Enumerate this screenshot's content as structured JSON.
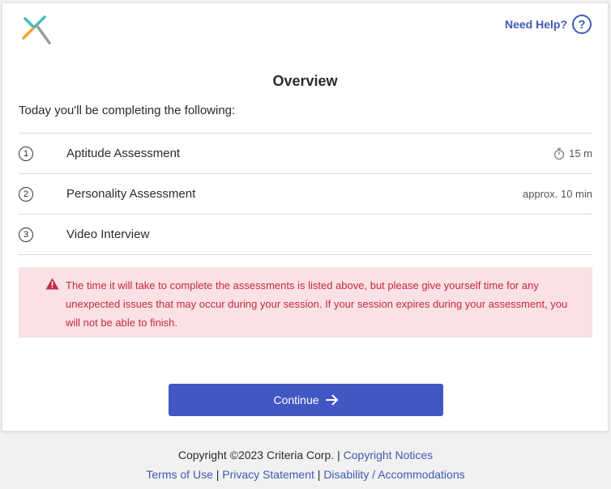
{
  "header": {
    "logo_icon": "criteria-x-logo",
    "help_label": "Need Help?",
    "help_icon": "question-circle-icon"
  },
  "main": {
    "title": "Overview",
    "intro": "Today you'll be completing the following:",
    "items": [
      {
        "number": "1",
        "label": "Aptitude Assessment",
        "time": "15 m",
        "icon": "stopwatch-icon"
      },
      {
        "number": "2",
        "label": "Personality Assessment",
        "time": "approx. 10 min"
      },
      {
        "number": "3",
        "label": "Video Interview",
        "time": ""
      }
    ],
    "warning": "The time it will take to complete the assessments is listed above, but please give yourself time for any unexpected issues that may occur during your session. If your session expires during your assessment, you will not be able to finish.",
    "continue_label": "Continue"
  },
  "footer": {
    "copyright": "Copyright ©2023 Criteria Corp.",
    "copyright_notices": "Copyright Notices",
    "terms": "Terms of Use",
    "privacy": "Privacy Statement",
    "disability": "Disability / Accommodations",
    "separator": "|"
  },
  "colors": {
    "accent": "#4158c4",
    "link": "#3f5bb5",
    "warning_bg": "#f9e1e6",
    "warning_text": "#c8283f"
  }
}
